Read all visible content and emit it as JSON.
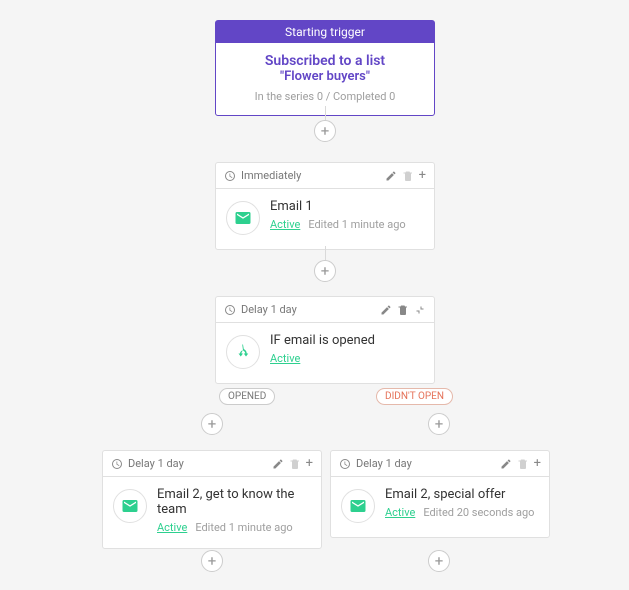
{
  "trigger": {
    "header": "Starting trigger",
    "title": "Subscribed to a list",
    "subtitle": "\"Flower buyers\"",
    "stats": "In the series 0 / Completed 0"
  },
  "step_email1": {
    "delay": "Immediately",
    "title": "Email 1",
    "status": "Active",
    "edited": "Edited 1 minute ago"
  },
  "step_condition": {
    "delay": "Delay 1 day",
    "title": "IF email is opened",
    "status": "Active"
  },
  "branch": {
    "opened": "OPENED",
    "not_opened": "DIDN'T OPEN"
  },
  "step_email2a": {
    "delay": "Delay 1 day",
    "title": "Email 2, get to know the team",
    "status": "Active",
    "edited": "Edited 1 minute ago"
  },
  "step_email2b": {
    "delay": "Delay 1 day",
    "title": "Email 2, special offer",
    "status": "Active",
    "edited": "Edited 20 seconds ago"
  }
}
